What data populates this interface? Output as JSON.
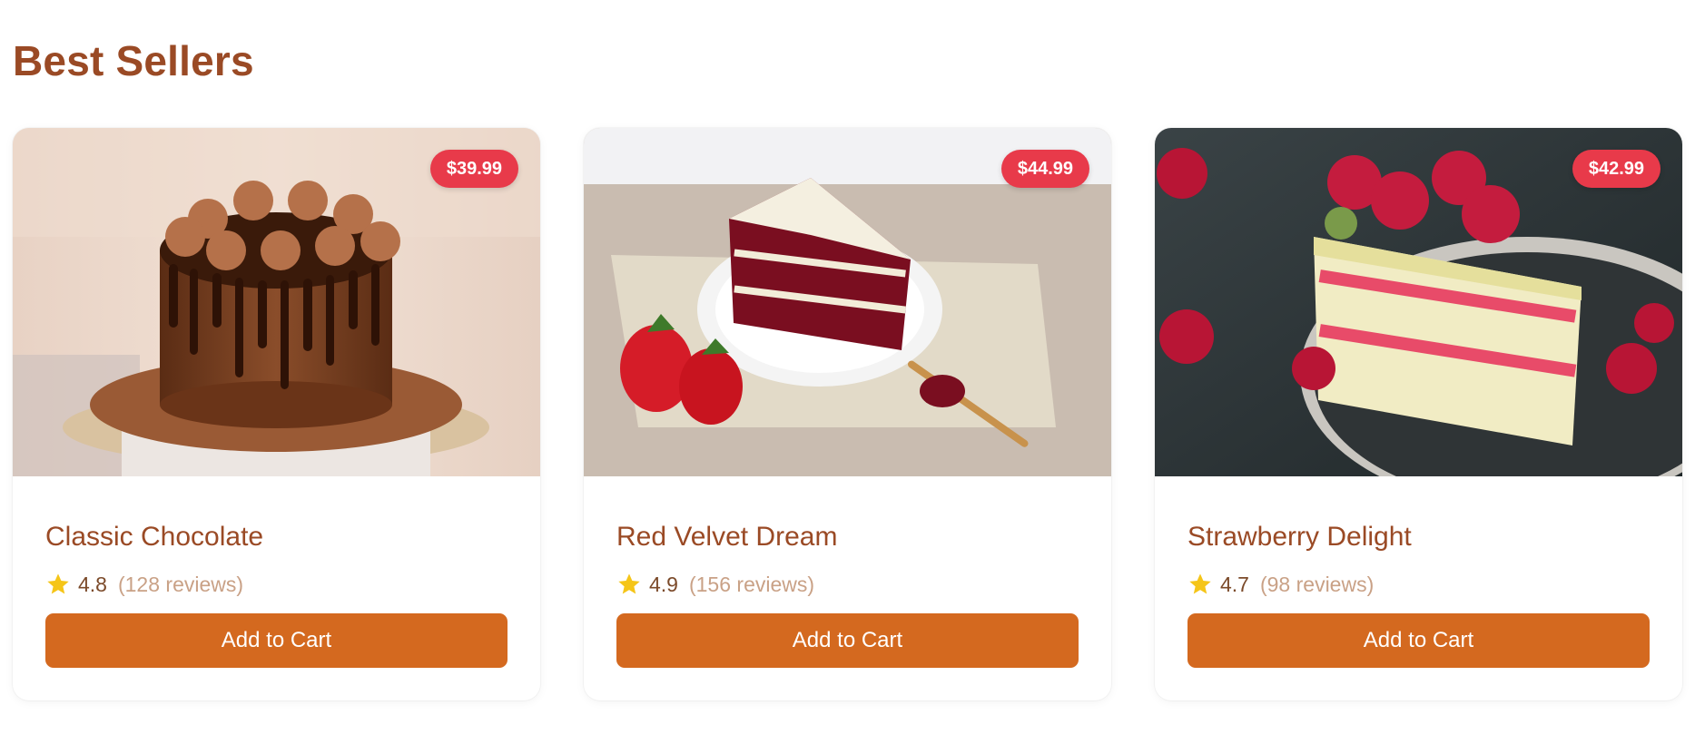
{
  "section": {
    "title": "Best Sellers"
  },
  "colors": {
    "title": "#9a4a25",
    "price_badge": "#e83a4a",
    "button": "#d4691f",
    "star": "#f5c518"
  },
  "products": [
    {
      "name": "Classic Chocolate",
      "price": "$39.99",
      "rating": "4.8",
      "reviews": "(128 reviews)",
      "button_label": "Add to Cart",
      "image": "chocolate-cake-image",
      "star_icon": "star-icon"
    },
    {
      "name": "Red Velvet Dream",
      "price": "$44.99",
      "rating": "4.9",
      "reviews": "(156 reviews)",
      "button_label": "Add to Cart",
      "image": "red-velvet-cake-image",
      "star_icon": "star-icon"
    },
    {
      "name": "Strawberry Delight",
      "price": "$42.99",
      "rating": "4.7",
      "reviews": "(98 reviews)",
      "button_label": "Add to Cart",
      "image": "strawberry-cake-image",
      "star_icon": "star-icon"
    }
  ]
}
